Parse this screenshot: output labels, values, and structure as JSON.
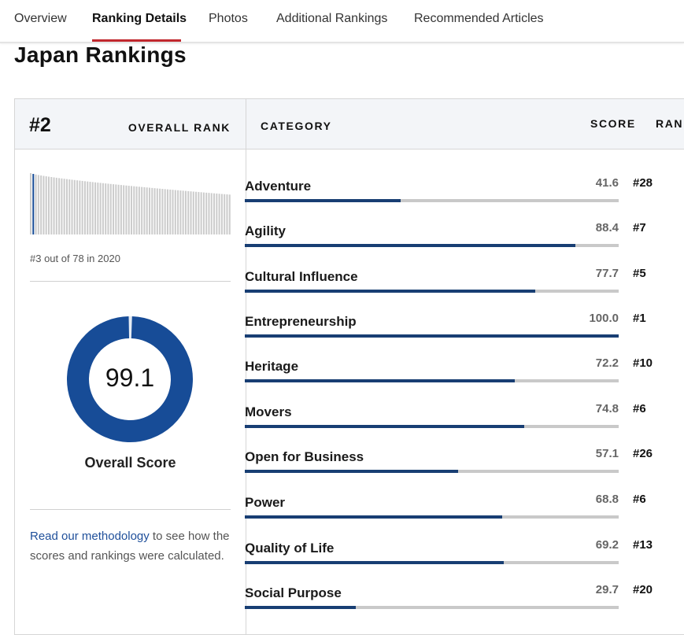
{
  "nav": {
    "tabs": [
      {
        "label": "Overview",
        "active": false
      },
      {
        "label": "Ranking Details",
        "active": true
      },
      {
        "label": "Photos",
        "active": false
      },
      {
        "label": "Additional Rankings",
        "active": false
      },
      {
        "label": "Recommended Articles",
        "active": false
      }
    ],
    "active_color": "#c1272d"
  },
  "page_title": "Japan Rankings",
  "overall": {
    "rank": "#2",
    "rank_label": "OVERALL RANK",
    "history_caption": "#3 out of 78 in 2020",
    "history_total": 78,
    "history_highlight_index": 2,
    "score": "99.1",
    "score_value": 99.1,
    "score_label": "Overall Score",
    "accent_color": "#174c97"
  },
  "methodology": {
    "link_text": "Read our methodology",
    "rest_text": " to see how the scores and rankings were calculated."
  },
  "table": {
    "headers": {
      "category": "CATEGORY",
      "score": "SCORE",
      "rank": "RANK"
    },
    "bar_color": "#183e73",
    "track_color": "#c9c9c9",
    "rows": [
      {
        "category": "Adventure",
        "score": "41.6",
        "value": 41.6,
        "rank": "#28"
      },
      {
        "category": "Agility",
        "score": "88.4",
        "value": 88.4,
        "rank": "#7"
      },
      {
        "category": "Cultural Influence",
        "score": "77.7",
        "value": 77.7,
        "rank": "#5"
      },
      {
        "category": "Entrepreneurship",
        "score": "100.0",
        "value": 100.0,
        "rank": "#1"
      },
      {
        "category": "Heritage",
        "score": "72.2",
        "value": 72.2,
        "rank": "#10"
      },
      {
        "category": "Movers",
        "score": "74.8",
        "value": 74.8,
        "rank": "#6"
      },
      {
        "category": "Open for Business",
        "score": "57.1",
        "value": 57.1,
        "rank": "#26"
      },
      {
        "category": "Power",
        "score": "68.8",
        "value": 68.8,
        "rank": "#6"
      },
      {
        "category": "Quality of Life",
        "score": "69.2",
        "value": 69.2,
        "rank": "#13"
      },
      {
        "category": "Social Purpose",
        "score": "29.7",
        "value": 29.7,
        "rank": "#20"
      }
    ]
  }
}
